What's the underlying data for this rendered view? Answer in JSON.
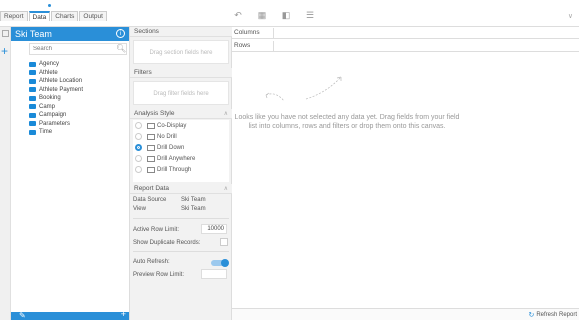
{
  "tabs": [
    {
      "label": "Report",
      "active": false
    },
    {
      "label": "Data",
      "active": true
    },
    {
      "label": "Charts",
      "active": false
    },
    {
      "label": "Output",
      "active": false
    }
  ],
  "toolbar": {
    "icons": [
      "undo-icon",
      "table-icon",
      "split-icon",
      "list-icon"
    ],
    "collapse_glyph": "∨"
  },
  "data_panel": {
    "title": "Ski Team",
    "search_placeholder": "Search",
    "folders": [
      "Agency",
      "Athlete",
      "Athlete Location",
      "Athlete Payment",
      "Booking",
      "Camp",
      "Campaign",
      "Parameters",
      "Time"
    ]
  },
  "sections": {
    "title": "Sections",
    "drop_hint": "Drag section fields here"
  },
  "filters": {
    "title": "Filters",
    "drop_hint": "Drag filter fields here"
  },
  "analysis_style": {
    "title": "Analysis Style",
    "options": [
      {
        "label": "Co-Display",
        "selected": false
      },
      {
        "label": "No Drill",
        "selected": false
      },
      {
        "label": "Drill Down",
        "selected": true
      },
      {
        "label": "Drill Anywhere",
        "selected": false
      },
      {
        "label": "Drill Through",
        "selected": false
      }
    ]
  },
  "report_data": {
    "title": "Report Data",
    "data_source_label": "Data Source",
    "data_source_value": "Ski Team",
    "view_label": "View",
    "view_value": "Ski Team",
    "active_row_limit_label": "Active Row Limit:",
    "active_row_limit_value": "10000",
    "show_duplicates_label": "Show Duplicate Records:",
    "auto_refresh_label": "Auto Refresh:",
    "auto_refresh_on": true,
    "preview_row_limit_label": "Preview Row Limit:",
    "preview_row_limit_value": ""
  },
  "canvas": {
    "columns_label": "Columns",
    "rows_label": "Rows",
    "empty_message": "Looks like you have not selected any data yet. Drag fields from your field list into columns, rows and filters or drop them onto this canvas."
  },
  "footer": {
    "refresh_label": "Refresh Report"
  },
  "colors": {
    "accent": "#2a8fd8",
    "folder": "#1a8ad8"
  }
}
